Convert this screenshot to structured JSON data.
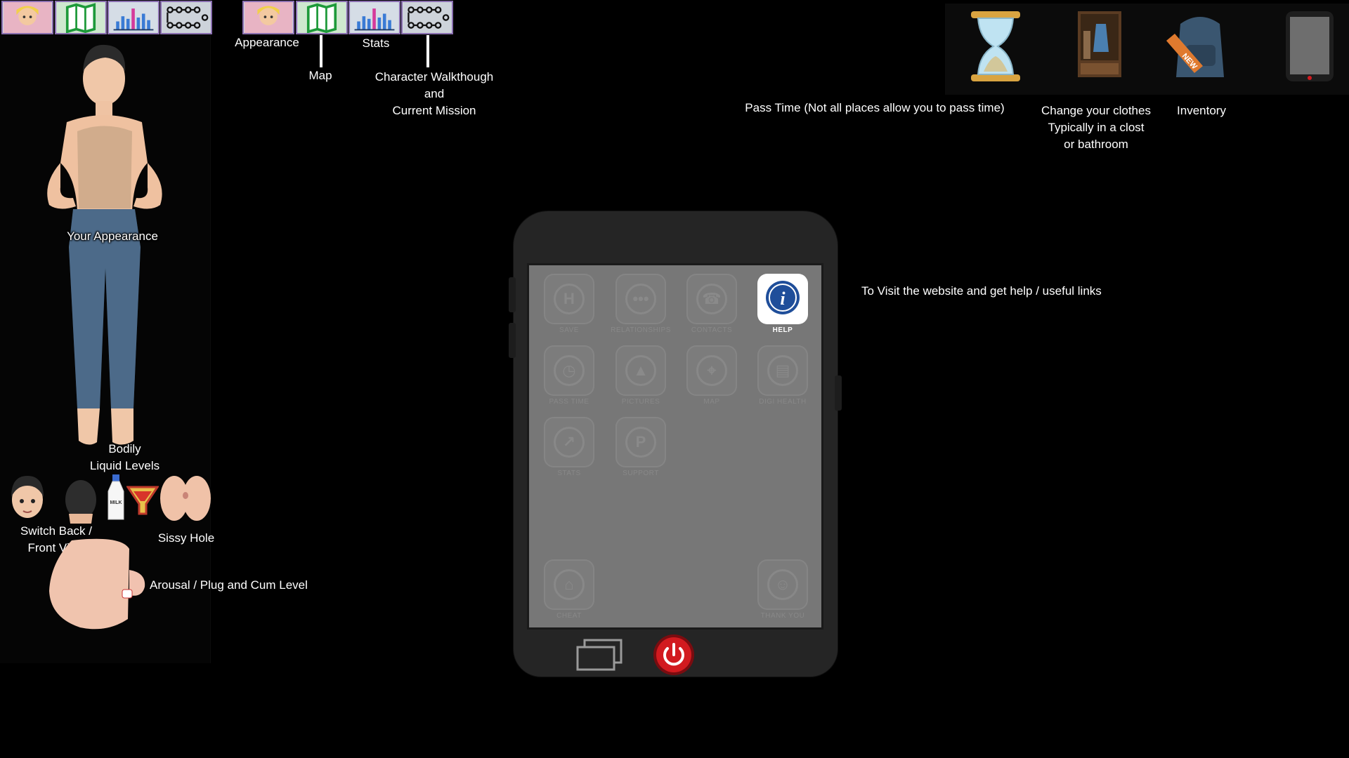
{
  "toolbar": {
    "buttons": [
      {
        "name": "appearance",
        "icon": "avatar-icon"
      },
      {
        "name": "map",
        "icon": "map-icon"
      },
      {
        "name": "stats",
        "icon": "bar-chart-icon"
      },
      {
        "name": "walkthrough",
        "icon": "flowchart-icon"
      }
    ]
  },
  "labels": {
    "appearance": "Appearance",
    "map": "Map",
    "stats": "Stats",
    "walkthrough_1": "Character Walkthough",
    "walkthrough_2": "and",
    "walkthrough_3": "Current Mission",
    "your_appearance": "Your Appearance",
    "liquid_1": "Bodily",
    "liquid_2": "Liquid Levels",
    "switch_1": "Switch Back /",
    "switch_2": "Front View",
    "sissy_hole": "Sissy Hole",
    "arousal": "Arousal / Plug and Cum Level",
    "pass_time": "Pass Time (Not all places allow you  to pass time)",
    "clothes_1": "Change your clothes",
    "clothes_2": "Typically in a clost",
    "clothes_3": "or bathroom",
    "inventory": "Inventory",
    "website": "To Visit the website and get help / useful links"
  },
  "top_right": {
    "items": [
      "hourglass-icon",
      "wardrobe-icon",
      "backpack-icon",
      "phone-icon"
    ],
    "new_badge": "NEW"
  },
  "bottle_label": "MILK",
  "phone": {
    "apps": [
      {
        "label": "SAVE",
        "glyph": "H"
      },
      {
        "label": "RELATIONSHIPS",
        "glyph": "•••"
      },
      {
        "label": "CONTACTS",
        "glyph": "☎"
      },
      {
        "label": "HELP",
        "glyph": "i"
      },
      {
        "label": "PASS TIME",
        "glyph": "◷"
      },
      {
        "label": "PICTURES",
        "glyph": "▲"
      },
      {
        "label": "MAP",
        "glyph": "⌖"
      },
      {
        "label": "DIGI HEALTH",
        "glyph": "▤"
      },
      {
        "label": "STATS",
        "glyph": "↗"
      },
      {
        "label": "SUPPORT",
        "glyph": "P"
      },
      {
        "label": "CHEAT",
        "glyph": "⌂"
      },
      {
        "label": "THANK YOU",
        "glyph": "☺"
      }
    ]
  },
  "colors": {
    "background": "#000000",
    "power_button": "#d21a1f",
    "help_icon": "#1f4e9a",
    "toolbar_border": "#8a6fb0"
  }
}
